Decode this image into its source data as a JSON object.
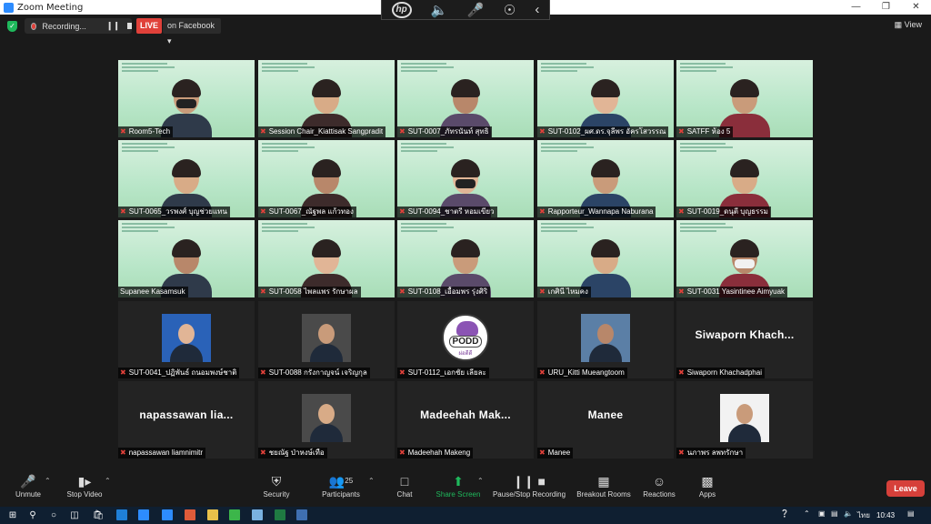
{
  "window": {
    "title": "Zoom Meeting"
  },
  "topbar": {
    "recording_label": "Recording...",
    "live_label": "LIVE",
    "stream_target": "on Facebook",
    "view_label": "View"
  },
  "tiles": [
    {
      "name": "Room5-Tech",
      "kind": "video"
    },
    {
      "name": "Session Chair_Kiattisak Sangpradit",
      "kind": "video"
    },
    {
      "name": "SUT-0007_ภัทรนันท์ สุทธิ",
      "kind": "video"
    },
    {
      "name": "SUT-0102_ผศ.ดร.จุลีพร อัครโสวรรณ",
      "kind": "video"
    },
    {
      "name": "SATFF ห้อง 5",
      "kind": "video"
    },
    {
      "name": "SUT-0065_วรพงศ์ บุญช่วยแทน",
      "kind": "video"
    },
    {
      "name": "SUT-0067_ณัฐพล แก้วทอง",
      "kind": "video"
    },
    {
      "name": "SUT-0094_ชาตรี หอมเขียว",
      "kind": "video"
    },
    {
      "name": "Rapporteur_Wannapa Naburana",
      "kind": "video"
    },
    {
      "name": "SUT-0019_ดนุตี บุญธรรม",
      "kind": "video"
    },
    {
      "name": "Supanee Kasamsuk",
      "kind": "video"
    },
    {
      "name": "SUT-0058 ไพลแพร รักษาผล",
      "kind": "video"
    },
    {
      "name": "SUT-0108_เอื้อมพร รุ่งศิริ",
      "kind": "video"
    },
    {
      "name": "เกศินี ไหมคง",
      "kind": "video"
    },
    {
      "name": "SUT-0031 Yasintinee Aimyuak",
      "kind": "video"
    },
    {
      "name": "SUT-0041_ปฏิพันธ์ ถนอมพงษ์ชาติ",
      "kind": "photo"
    },
    {
      "name": "SUT-0088 กรังกาญจน์ เจริญกุล",
      "kind": "photo"
    },
    {
      "name": "SUT-0112_เอกชัย เลียละ",
      "kind": "logo",
      "logo_text": "PODD",
      "logo_sub": "ผ่อดีดี"
    },
    {
      "name": "URU_Kitti Mueangtoom",
      "kind": "photo"
    },
    {
      "name": "Siwaporn Khachadphai",
      "kind": "text",
      "big": "Siwaporn  Khach..."
    },
    {
      "name": "napassawan liamnimitr",
      "kind": "text",
      "big": "napassawan  lia..."
    },
    {
      "name": "ชยณัฐ ป่าหงษ์เทือ",
      "kind": "photo"
    },
    {
      "name": "Madeehah Makeng",
      "kind": "text",
      "big": "Madeehah  Mak..."
    },
    {
      "name": "Manee",
      "kind": "text",
      "big": "Manee"
    },
    {
      "name": "นภาพร ลพทรักษา",
      "kind": "photo"
    }
  ],
  "toolbar": {
    "unmute": "Unmute",
    "stop_video": "Stop Video",
    "security": "Security",
    "participants": "Participants",
    "participants_count": "25",
    "chat": "Chat",
    "share_screen": "Share Screen",
    "pause_stop_recording": "Pause/Stop Recording",
    "breakout_rooms": "Breakout Rooms",
    "reactions": "Reactions",
    "apps": "Apps",
    "leave": "Leave"
  },
  "taskbar": {
    "language": "ไทย",
    "time": "10:43"
  },
  "colors": {
    "background": "#1a1a1a",
    "live_red": "#e0413a",
    "share_green": "#1fb95c",
    "active_speaker": "#d4ee4a",
    "leave_red": "#d6403a"
  }
}
